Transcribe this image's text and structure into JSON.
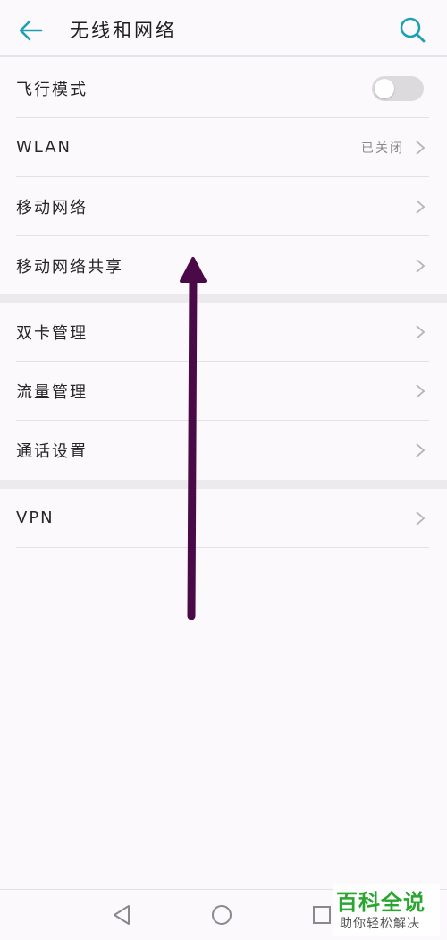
{
  "header": {
    "title": "无线和网络",
    "back_icon": "arrow-left-icon",
    "search_icon": "search-icon",
    "accent_color": "#1ea0b4"
  },
  "group1": {
    "items": [
      {
        "label": "飞行模式",
        "type": "toggle",
        "toggle_on": false
      },
      {
        "label": "WLAN",
        "value": "已关闭"
      },
      {
        "label": "移动网络"
      },
      {
        "label": "移动网络共享"
      }
    ]
  },
  "group2": {
    "items": [
      {
        "label": "双卡管理"
      },
      {
        "label": "流量管理"
      },
      {
        "label": "通话设置"
      }
    ]
  },
  "group3": {
    "items": [
      {
        "label": "VPN"
      }
    ]
  },
  "annotation": {
    "arrow_direction": "up",
    "arrow_color": "#4a0a48"
  },
  "navbar": {
    "back_icon": "triangle-back-icon",
    "home_icon": "circle-home-icon",
    "recents_icon": "square-recents-icon"
  },
  "watermark": {
    "main": "百科全说",
    "sub": "助你轻松解决",
    "color": "#2aa52f"
  }
}
